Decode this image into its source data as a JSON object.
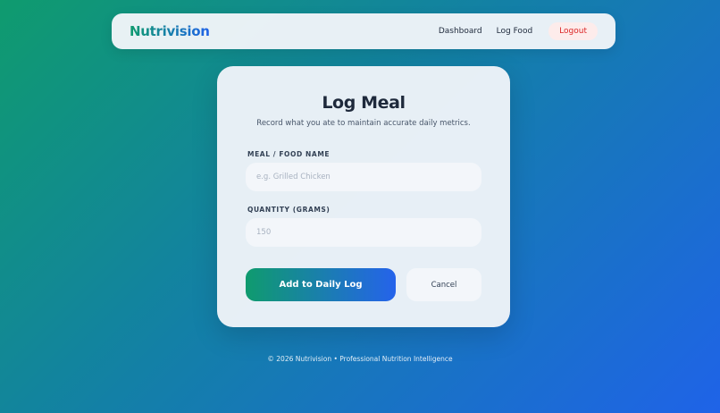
{
  "nav": {
    "brand": "Nutrivision",
    "links": [
      {
        "label": "Dashboard"
      },
      {
        "label": "Log Food"
      }
    ],
    "logout_label": "Logout"
  },
  "form": {
    "title": "Log Meal",
    "subtitle": "Record what you ate to maintain accurate daily metrics.",
    "meal_label": "MEAL / FOOD NAME",
    "meal_placeholder": "e.g. Grilled Chicken",
    "meal_value": "",
    "quantity_label": "QUANTITY (GRAMS)",
    "quantity_placeholder": "150",
    "quantity_value": "",
    "submit_label": "Add to Daily Log",
    "cancel_label": "Cancel"
  },
  "footer": {
    "text": "© 2026 Nutrivision • Professional Nutrition Intelligence"
  },
  "colors": {
    "gradient_start": "#0f9b6e",
    "gradient_end": "#1f63e8",
    "logout_text": "#dc2626",
    "card_background": "#eef3f8"
  }
}
